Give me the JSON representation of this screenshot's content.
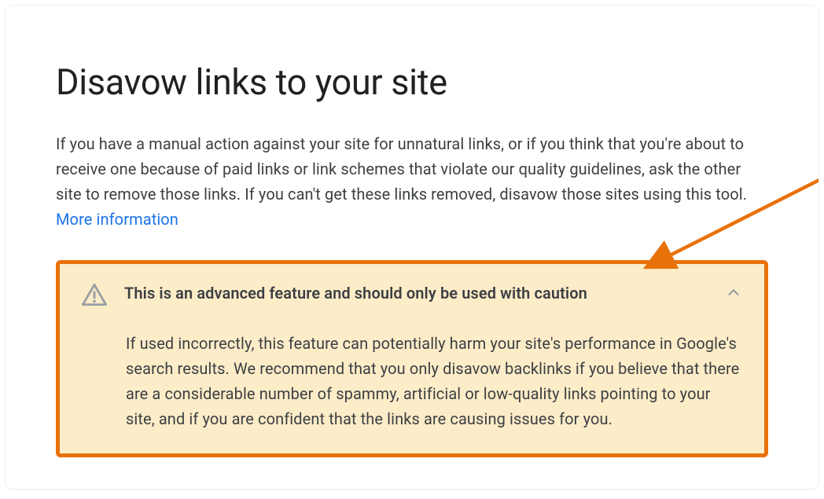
{
  "page": {
    "title": "Disavow links to your site",
    "intro_text": "If you have a manual action against your site for unnatural links, or if you think that you're about to receive one because of paid links or link schemes that violate our quality guidelines, ask the other site to remove those links. If you can't get these links removed, disavow those sites using this tool. ",
    "more_info_label": "More information"
  },
  "warning": {
    "title": "This is an advanced feature and should only be used with caution",
    "body": "If used incorrectly, this feature can potentially harm your site's performance in Google's search results. We recommend that you only disavow backlinks if you believe that there are a considerable number of spammy, artificial or low-quality links pointing to your site, and if you are confident that the links are causing issues for you."
  },
  "colors": {
    "accent_orange": "#e8710a",
    "warning_bg": "#fdecc8",
    "link_blue": "#1a73e8"
  }
}
